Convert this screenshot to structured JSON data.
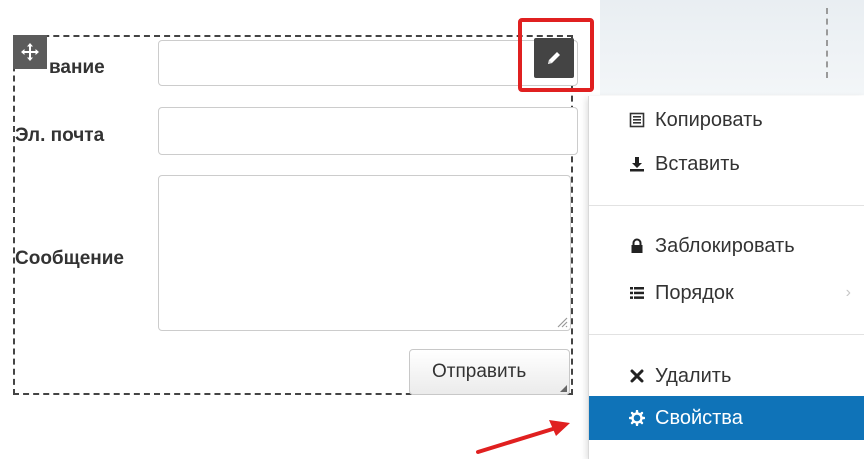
{
  "form": {
    "labels": {
      "name": "вание",
      "email": "Эл. почта",
      "message": "Сообщение"
    },
    "submit_label": "Отправить"
  },
  "context_menu": {
    "items": [
      {
        "label": "Копировать",
        "icon": "copy-icon"
      },
      {
        "label": "Вставить",
        "icon": "paste-icon"
      },
      {
        "label": "Заблокировать",
        "icon": "lock-icon"
      },
      {
        "label": "Порядок",
        "icon": "list-icon"
      },
      {
        "label": "Удалить",
        "icon": "close-icon"
      },
      {
        "label": "Свойства",
        "icon": "gear-icon"
      }
    ]
  },
  "colors": {
    "highlight": "#e02020",
    "menu_active": "#0f73b8"
  }
}
